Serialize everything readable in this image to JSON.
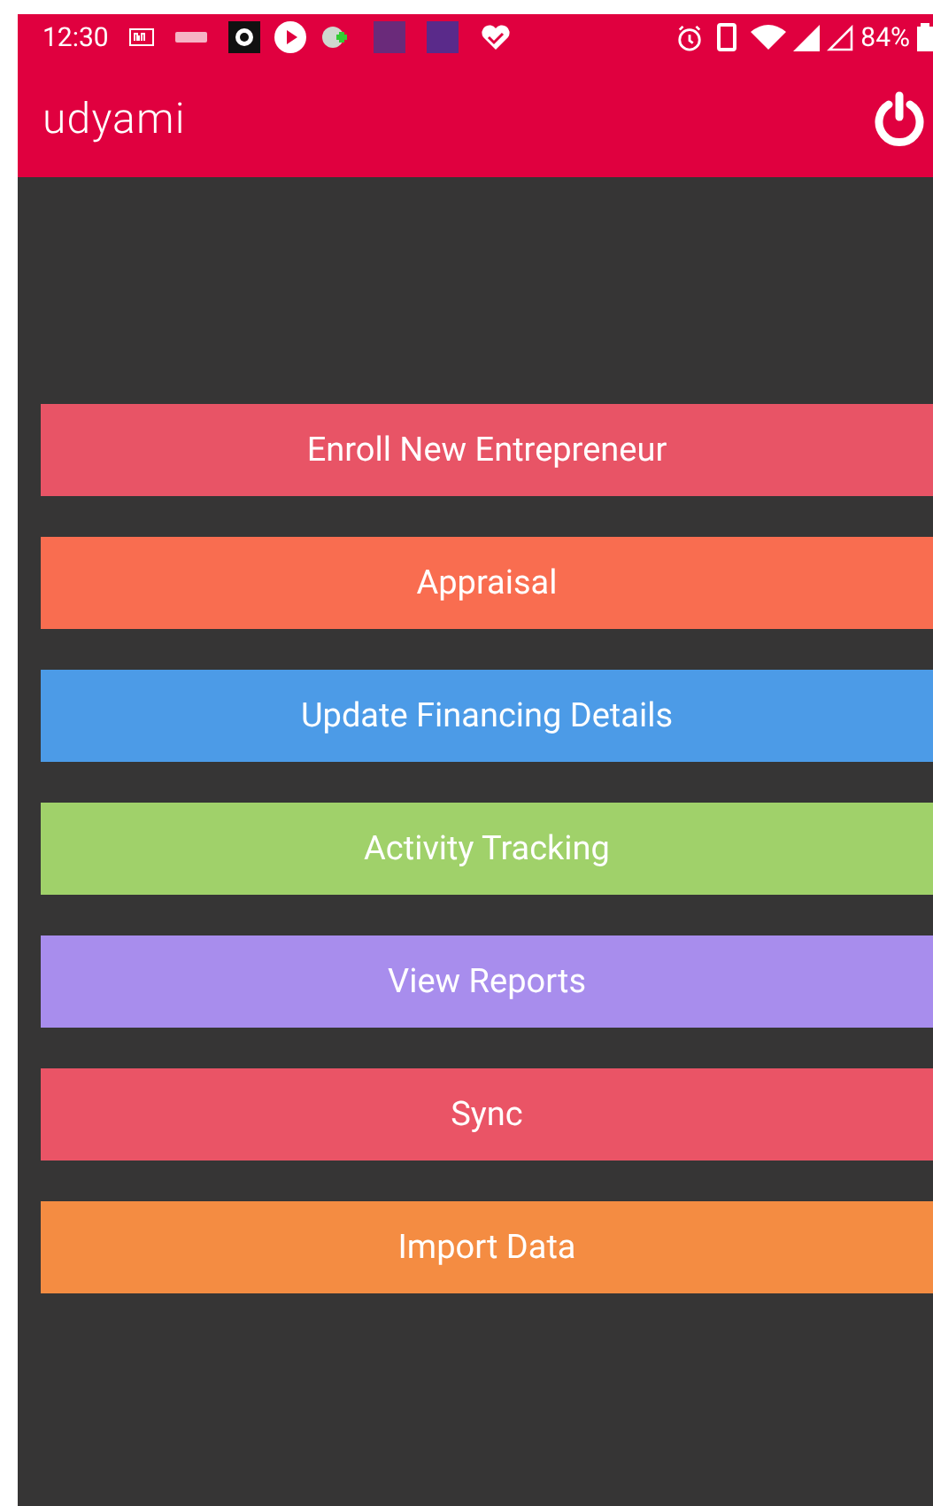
{
  "status_bar": {
    "time": "12:30",
    "battery": "84%"
  },
  "app_bar": {
    "title": "udyami"
  },
  "menu": [
    {
      "label": "Enroll New Entrepreneur",
      "color": "#e85466"
    },
    {
      "label": "Appraisal",
      "color": "#f96d50"
    },
    {
      "label": "Update Financing Details",
      "color": "#4c9be7"
    },
    {
      "label": "Activity Tracking",
      "color": "#a0d16a"
    },
    {
      "label": "View Reports",
      "color": "#a88ded"
    },
    {
      "label": "Sync",
      "color": "#ea5466"
    },
    {
      "label": "Import Data",
      "color": "#f48c42"
    }
  ]
}
